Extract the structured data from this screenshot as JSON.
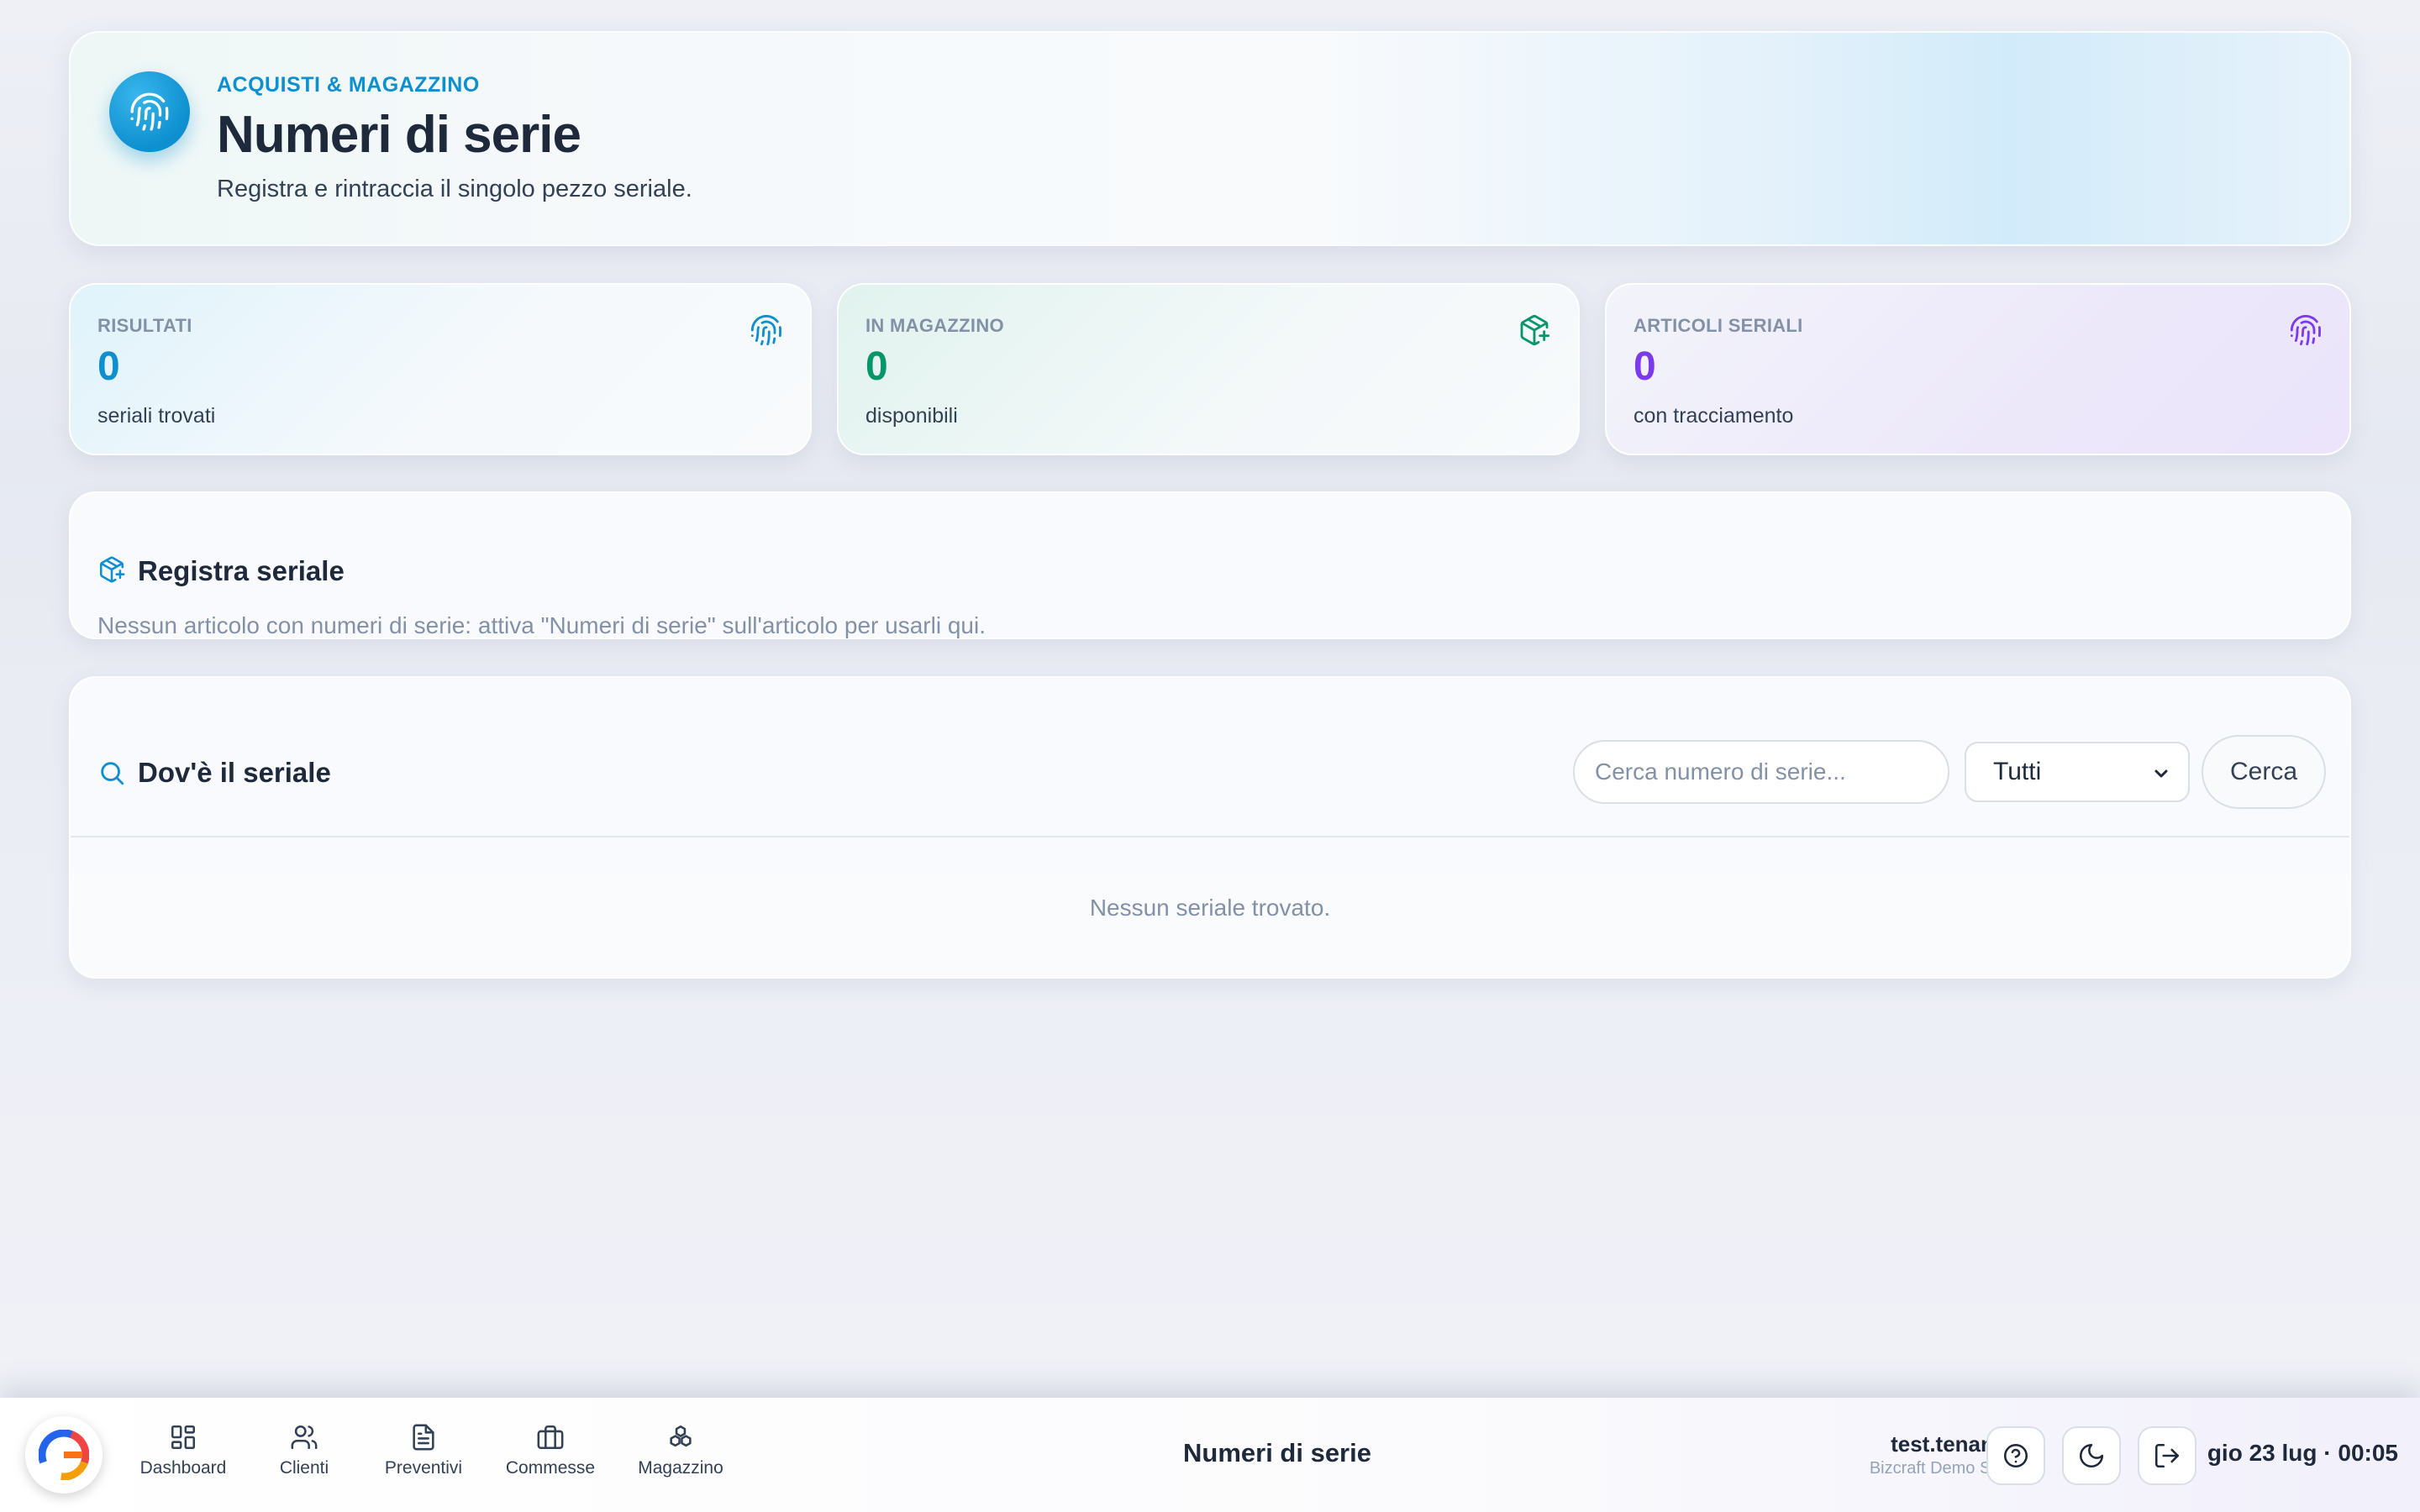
{
  "hero": {
    "eyebrow": "ACQUISTI & MAGAZZINO",
    "title": "Numeri di serie",
    "subtitle": "Registra e rintraccia il singolo pezzo seriale.",
    "icon": "fingerprint-icon"
  },
  "stats": [
    {
      "label": "RISULTATI",
      "value": "0",
      "caption": "seriali trovati",
      "icon": "fingerprint-icon",
      "color": "#0e8fcf"
    },
    {
      "label": "IN MAGAZZINO",
      "value": "0",
      "caption": "disponibili",
      "icon": "package-plus-icon",
      "color": "#059669"
    },
    {
      "label": "ARTICOLI SERIALI",
      "value": "0",
      "caption": "con tracciamento",
      "icon": "fingerprint-icon",
      "color": "#7c3aed"
    }
  ],
  "register": {
    "title": "Registra seriale",
    "note": "Nessun articolo con numeri di serie: attiva \"Numeri di serie\" sull'articolo per usarli qui.",
    "icon": "package-icon"
  },
  "search": {
    "title": "Dov'è il seriale",
    "placeholder": "Cerca numero di serie...",
    "filter_selected": "Tutti",
    "button": "Cerca",
    "empty": "Nessun seriale trovato.",
    "icon": "search-icon"
  },
  "bottombar": {
    "nav": [
      {
        "label": "Dashboard",
        "icon": "grid-icon"
      },
      {
        "label": "Clienti",
        "icon": "users-icon"
      },
      {
        "label": "Preventivi",
        "icon": "document-icon"
      },
      {
        "label": "Commesse",
        "icon": "briefcase-icon"
      },
      {
        "label": "Magazzino",
        "icon": "boxes-icon"
      }
    ],
    "page_title": "Numeri di serie",
    "user_name": "test.tenant1",
    "user_org": "Bizcraft Demo S.r.l.",
    "clock": "gio 23 lug · 00:05"
  },
  "colors": {
    "accent": "#0e8fcf",
    "green": "#059669",
    "purple": "#7c3aed"
  }
}
